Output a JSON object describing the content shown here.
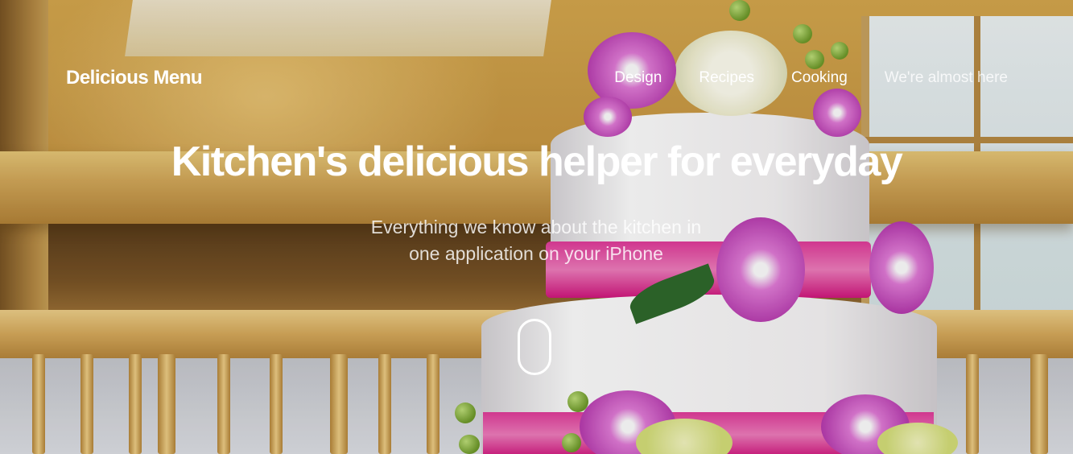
{
  "brand": {
    "name": "Delicious Menu"
  },
  "nav": {
    "items": [
      {
        "label": "Design"
      },
      {
        "label": "Recipes"
      },
      {
        "label": "Cooking"
      },
      {
        "label": "We're almost here"
      }
    ]
  },
  "hero": {
    "title": "Kitchen's delicious helper for everyday",
    "subtitle_line1": "Everything we know about the kitchen in",
    "subtitle_line2": "one application on your iPhone",
    "scroll_icon": "mouse-icon",
    "background": "wedding-cake-photo"
  },
  "colors": {
    "text": "#ffffff",
    "ribbon": "#e23c9b"
  }
}
